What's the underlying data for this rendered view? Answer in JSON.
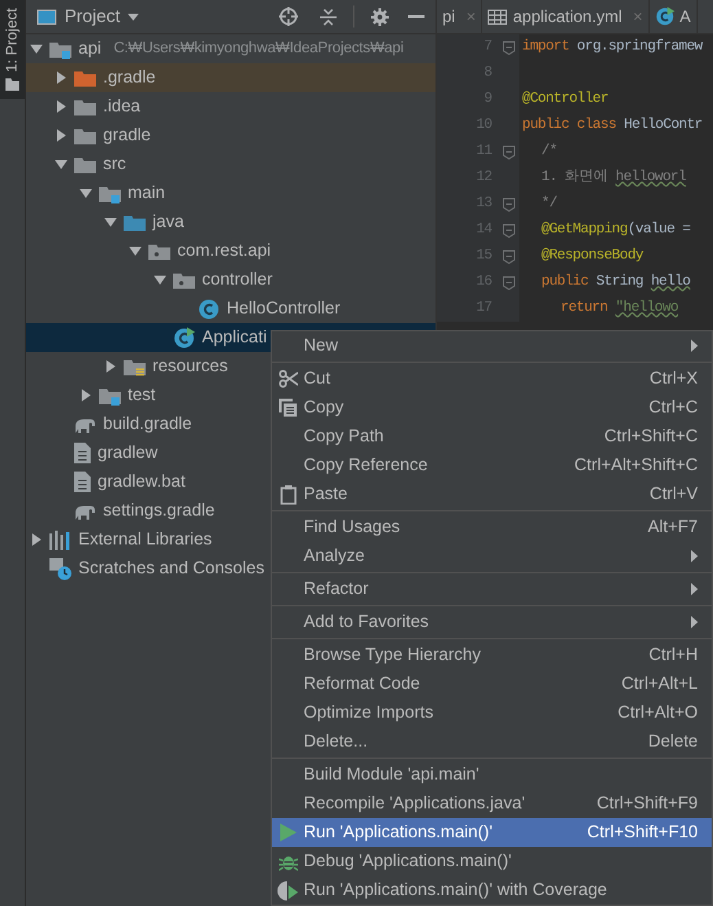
{
  "tool_strip": {
    "label": "1: Project",
    "selected": true
  },
  "project_panel": {
    "title": "Project",
    "tree": [
      {
        "label": "api",
        "path": "C:₩Users₩kimyonghwa₩IdeaProjects₩api",
        "kind": "module",
        "expanded": true,
        "selected": false,
        "children": [
          {
            "label": ".gradle",
            "kind": "excluded",
            "expanded": false,
            "selected": false
          },
          {
            "label": ".idea",
            "kind": "folder",
            "expanded": false,
            "selected": false
          },
          {
            "label": "gradle",
            "kind": "folder",
            "expanded": false,
            "selected": false
          },
          {
            "label": "src",
            "kind": "folder",
            "expanded": true,
            "selected": false,
            "children": [
              {
                "label": "main",
                "kind": "module",
                "expanded": true,
                "selected": false,
                "children": [
                  {
                    "label": "java",
                    "kind": "source",
                    "expanded": true,
                    "selected": false,
                    "children": [
                      {
                        "label": "com.rest.api",
                        "kind": "package",
                        "expanded": true,
                        "selected": false,
                        "children": [
                          {
                            "label": "controller",
                            "kind": "package",
                            "expanded": true,
                            "selected": false,
                            "children": [
                              {
                                "label": "HelloController",
                                "kind": "class",
                                "selected": false
                              }
                            ]
                          },
                          {
                            "label": "Applicati",
                            "kind": "app-class",
                            "selected": true
                          }
                        ]
                      }
                    ]
                  },
                  {
                    "label": "resources",
                    "kind": "resources",
                    "expanded": false,
                    "selected": false
                  }
                ]
              },
              {
                "label": "test",
                "kind": "module",
                "expanded": false,
                "selected": false
              }
            ]
          },
          {
            "label": "build.gradle",
            "kind": "gradle",
            "selected": false
          },
          {
            "label": "gradlew",
            "kind": "file",
            "selected": false
          },
          {
            "label": "gradlew.bat",
            "kind": "file",
            "selected": false
          },
          {
            "label": "settings.gradle",
            "kind": "gradle",
            "selected": false
          }
        ]
      },
      {
        "label": "External Libraries",
        "kind": "libraries",
        "expanded": false,
        "selected": false
      },
      {
        "label": "Scratches and Consoles",
        "kind": "scratches",
        "selected": false
      }
    ]
  },
  "editor_tabs": [
    {
      "label": "pi",
      "kind": "plain",
      "close": "×"
    },
    {
      "label": "application.yml",
      "kind": "yml",
      "close": "×"
    },
    {
      "label": "A",
      "kind": "class"
    }
  ],
  "code_lines": [
    {
      "number": "7",
      "fold": true,
      "segments": [
        {
          "kind": "keyword",
          "text": "import"
        },
        {
          "kind": "plain",
          "text": " org.springframew"
        }
      ]
    },
    {
      "number": "8",
      "fold": false
    },
    {
      "number": "9",
      "fold": false,
      "segments": [
        {
          "kind": "annotation",
          "text": "@Controller"
        }
      ]
    },
    {
      "number": "10",
      "fold": false,
      "segments": [
        {
          "kind": "keyword",
          "text": "public class "
        },
        {
          "kind": "plain",
          "text": "HelloContr"
        }
      ],
      "children": [
        {
          "number": "11",
          "fold": true,
          "segments": [
            {
              "kind": "comment",
              "text": "/*"
            }
          ]
        },
        {
          "number": "12",
          "fold": false,
          "segments": [
            {
              "kind": "comment",
              "text": "1. 화면에 "
            },
            {
              "kind": "comment-typo",
              "text": "helloworl"
            }
          ]
        },
        {
          "number": "13",
          "fold": true,
          "segments": [
            {
              "kind": "comment",
              "text": "*/"
            }
          ]
        },
        {
          "number": "14",
          "fold": true,
          "segments": [
            {
              "kind": "annotation",
              "text": "@GetMapping"
            },
            {
              "kind": "plain",
              "text": "(value ="
            }
          ]
        },
        {
          "number": "15",
          "fold": true,
          "segments": [
            {
              "kind": "annotation",
              "text": "@ResponseBody"
            }
          ]
        },
        {
          "number": "16",
          "fold": true,
          "segments": [
            {
              "kind": "keyword",
              "text": "public "
            },
            {
              "kind": "plain",
              "text": "String "
            },
            {
              "kind": "typo",
              "text": "hello"
            }
          ],
          "children": [
            {
              "number": "17",
              "fold": false,
              "segments": [
                {
                  "kind": "keyword",
                  "text": "return "
                },
                {
                  "kind": "string-typo",
                  "text": "\"hellowo"
                }
              ]
            }
          ]
        }
      ]
    }
  ],
  "context_menu": [
    {
      "kind": "submenu",
      "label": "New",
      "selected": false
    },
    {
      "kind": "separator"
    },
    {
      "kind": "cut",
      "label": "Cut",
      "shortcut": "Ctrl+X",
      "selected": false
    },
    {
      "kind": "copy",
      "label": "Copy",
      "shortcut": "Ctrl+C",
      "selected": false
    },
    {
      "kind": "item",
      "label": "Copy Path",
      "shortcut": "Ctrl+Shift+C",
      "selected": false
    },
    {
      "kind": "item",
      "label": "Copy Reference",
      "shortcut": "Ctrl+Alt+Shift+C",
      "selected": false
    },
    {
      "kind": "paste",
      "label": "Paste",
      "shortcut": "Ctrl+V",
      "selected": false
    },
    {
      "kind": "separator"
    },
    {
      "kind": "item",
      "label": "Find Usages",
      "shortcut": "Alt+F7",
      "selected": false
    },
    {
      "kind": "submenu",
      "label": "Analyze",
      "selected": false
    },
    {
      "kind": "separator"
    },
    {
      "kind": "submenu",
      "label": "Refactor",
      "selected": false
    },
    {
      "kind": "separator"
    },
    {
      "kind": "submenu",
      "label": "Add to Favorites",
      "selected": false
    },
    {
      "kind": "separator"
    },
    {
      "kind": "item",
      "label": "Browse Type Hierarchy",
      "shortcut": "Ctrl+H",
      "selected": false
    },
    {
      "kind": "item",
      "label": "Reformat Code",
      "shortcut": "Ctrl+Alt+L",
      "selected": false
    },
    {
      "kind": "item",
      "label": "Optimize Imports",
      "shortcut": "Ctrl+Alt+O",
      "selected": false
    },
    {
      "kind": "item",
      "label": "Delete...",
      "shortcut": "Delete",
      "selected": false
    },
    {
      "kind": "separator"
    },
    {
      "kind": "item",
      "label": "Build Module 'api.main'",
      "selected": false
    },
    {
      "kind": "item",
      "label": "Recompile 'Applications.java'",
      "shortcut": "Ctrl+Shift+F9",
      "selected": false
    },
    {
      "kind": "run",
      "label": "Run 'Applications.main()'",
      "shortcut": "Ctrl+Shift+F10",
      "selected": true
    },
    {
      "kind": "debug",
      "label": "Debug 'Applications.main()'",
      "selected": false
    },
    {
      "kind": "coverage",
      "label": "Run 'Applications.main()' with Coverage",
      "selected": false
    }
  ]
}
